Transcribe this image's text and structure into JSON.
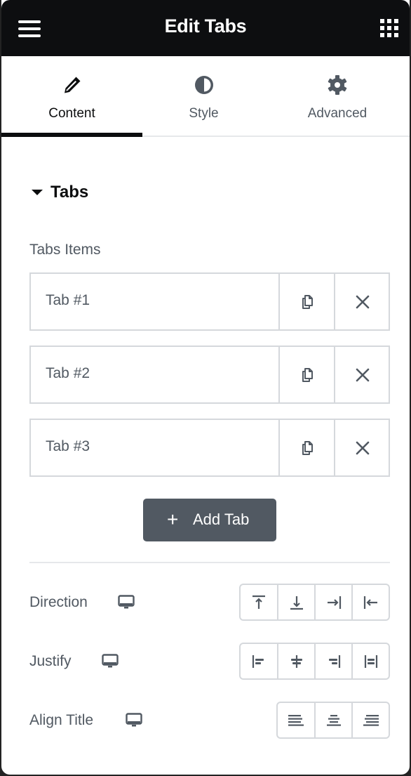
{
  "header": {
    "title": "Edit Tabs",
    "menu_icon": "hamburger-icon",
    "apps_icon": "grid-icon"
  },
  "panel_tabs": [
    {
      "label": "Content",
      "icon": "pencil-icon",
      "active": true
    },
    {
      "label": "Style",
      "icon": "contrast-icon",
      "active": false
    },
    {
      "label": "Advanced",
      "icon": "gear-icon",
      "active": false
    }
  ],
  "section": {
    "title": "Tabs",
    "expanded": true
  },
  "repeater": {
    "label": "Tabs Items",
    "items": [
      {
        "title": "Tab #1"
      },
      {
        "title": "Tab #2"
      },
      {
        "title": "Tab #3"
      }
    ],
    "duplicate_icon": "duplicate-icon",
    "remove_icon": "close-icon",
    "add_label": "Add Tab",
    "add_icon": "+"
  },
  "controls": [
    {
      "label": "Direction",
      "responsive_icon": "desktop-icon",
      "options": [
        "align-top-icon",
        "align-bottom-icon",
        "align-end-icon",
        "align-start-icon"
      ]
    },
    {
      "label": "Justify",
      "responsive_icon": "desktop-icon",
      "options": [
        "justify-start-icon",
        "justify-center-icon",
        "justify-end-icon",
        "justify-stretch-icon"
      ]
    },
    {
      "label": "Align Title",
      "responsive_icon": "desktop-icon",
      "options": [
        "text-align-left-icon",
        "text-align-center-icon",
        "text-align-right-icon"
      ]
    }
  ],
  "colors": {
    "header_bg": "#0d0e10",
    "text_primary": "#0c0d0e",
    "text_secondary": "#515962",
    "border": "#d5d8dc",
    "button_bg": "#515962"
  }
}
